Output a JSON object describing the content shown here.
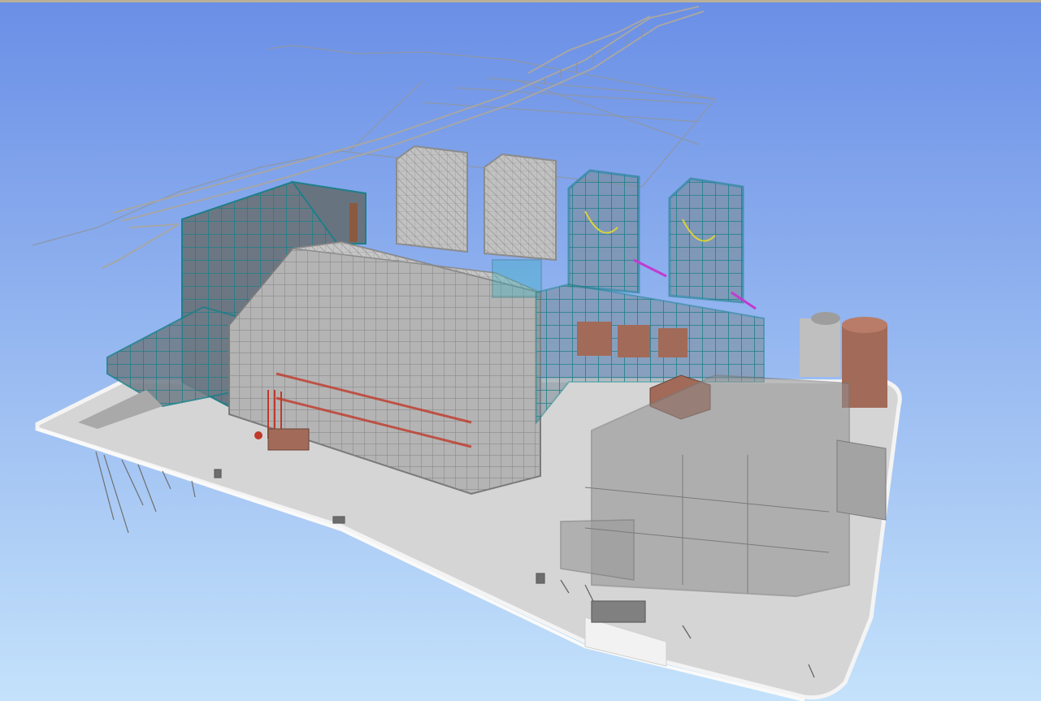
{
  "viewer": {
    "view": "3d-perspective",
    "background": {
      "top": "#6a8fe6",
      "bottom": "#c4e2fb"
    },
    "colors": {
      "ground": "#d6d6d6",
      "ground_edge": "#f4f4f4",
      "steel_grey": "#9a9a9a",
      "steel_teal": "#1f7f88",
      "building_glass": "#8f8f8f",
      "tank_copper": "#a26a58",
      "piping_magenta": "#c23ad0",
      "piping_yellow": "#d8d23a",
      "piping_red": "#c0392b",
      "outline": "#7a7a7a"
    },
    "icons": [
      "steel-frame-icon",
      "tank-icon",
      "pipe-rack-icon"
    ]
  }
}
